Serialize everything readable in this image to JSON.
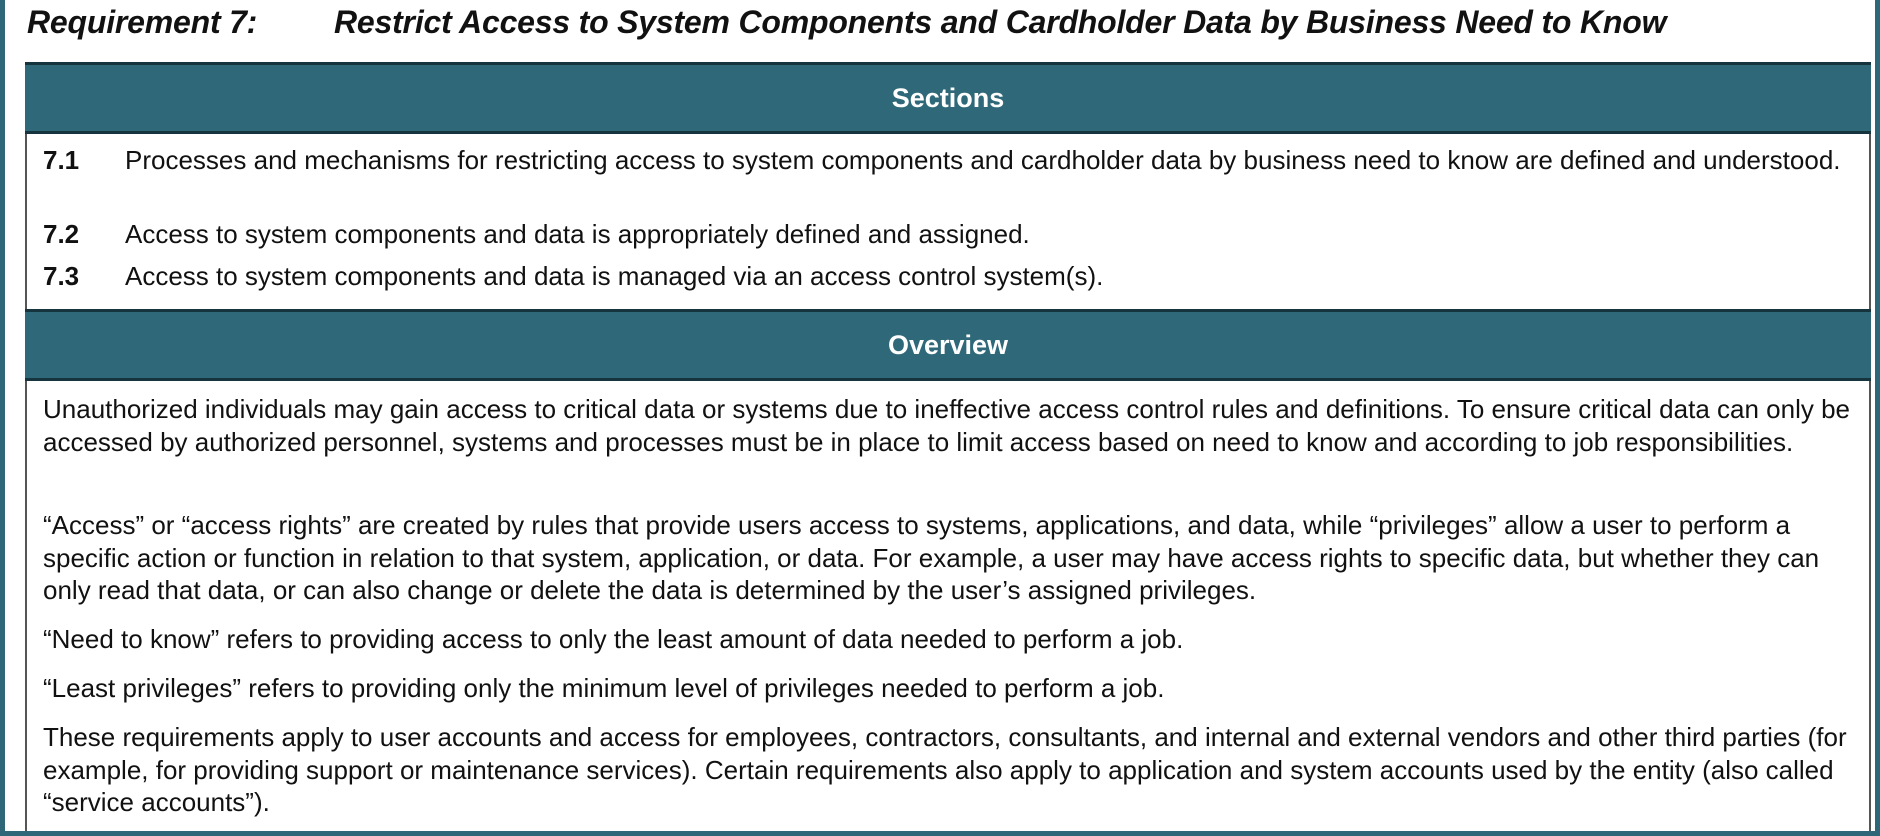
{
  "requirement": {
    "number": "Requirement 7:",
    "title": "Restrict Access to System Components and Cardholder Data by Business Need to Know"
  },
  "sections_header": "Sections",
  "sections": [
    {
      "num": "7.1",
      "text": "Processes and mechanisms for restricting access to system components and cardholder data by business need to know are defined and understood."
    },
    {
      "num": "7.2",
      "text": "Access to system components and data is appropriately defined and assigned."
    },
    {
      "num": "7.3",
      "text": "Access to system components and data is managed via an access control system(s)."
    }
  ],
  "overview_header": "Overview",
  "overview_paragraphs": [
    "Unauthorized individuals may gain access to critical data or systems due to ineffective access control rules and definitions. To ensure critical data can only be accessed by authorized personnel, systems and processes must be in place to limit access based on need to know and according to job responsibilities.",
    "“Access” or “access rights” are created by rules that provide users access to systems, applications, and data, while “privileges” allow a user to perform a specific action or function in relation to that system, application, or data. For example, a user may have access rights to specific data, but whether they can only read that data, or can also change or delete the data is determined by the user’s assigned privileges.",
    "“Need to know” refers to providing access to only the least amount of data needed to perform a job.",
    "“Least privileges” refers to providing only the minimum level of privileges needed to perform a job.",
    "These requirements apply to user accounts and access for employees, contractors, consultants, and internal and external vendors and other third parties (for example, for providing support or maintenance services). Certain requirements also apply to application and system accounts used by the entity (also called “service accounts”)."
  ],
  "colors": {
    "band": "#2f6878",
    "band_border": "#16343d",
    "frame": "#2e6878"
  }
}
